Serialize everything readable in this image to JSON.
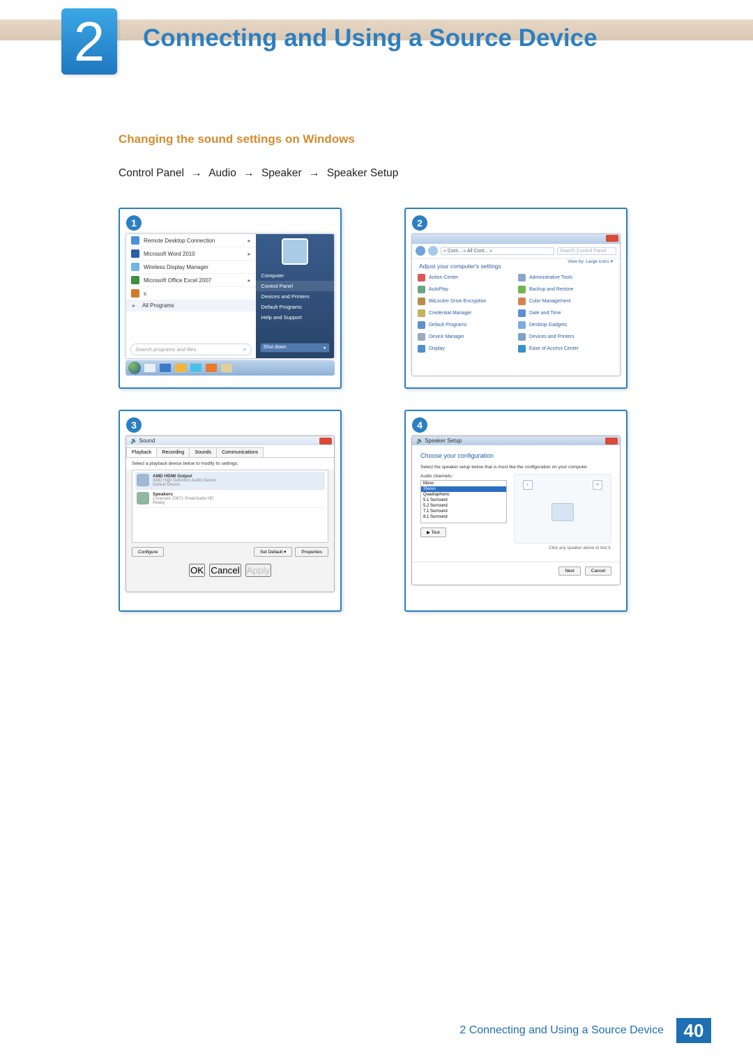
{
  "chapter": {
    "number": "2",
    "title": "Connecting and Using a Source Device"
  },
  "section_heading": "Changing the sound settings on Windows",
  "path": {
    "p1": "Control Panel",
    "p2": "Audio",
    "p3": "Speaker",
    "p4": "Speaker Setup",
    "arrow": "→"
  },
  "steps": {
    "n1": "1",
    "n2": "2",
    "n3": "3",
    "n4": "4"
  },
  "start_menu": {
    "items": [
      "Remote Desktop Connection",
      "Microsoft Word 2010",
      "Wireless Display Manager",
      "Microsoft Office Excel 2007",
      "s"
    ],
    "all_programs": "All Programs",
    "search_placeholder": "Search programs and files",
    "right": [
      "Computer",
      "Control Panel",
      "Devices and Printers",
      "Default Programs",
      "Help and Support"
    ],
    "shutdown": "Shut down"
  },
  "control_panel": {
    "breadcrumb": "« Cont... » All Cont... »",
    "search_placeholder": "Search Control Panel",
    "adjust": "Adjust your computer's settings",
    "view": "View by:  Large icons ▾",
    "items_left": [
      "Action Center",
      "AutoPlay",
      "BitLocker Drive Encryption",
      "Credential Manager",
      "Default Programs",
      "Device Manager",
      "Display"
    ],
    "items_right": [
      "Administrative Tools",
      "Backup and Restore",
      "Color Management",
      "Date and Time",
      "Desktop Gadgets",
      "Devices and Printers",
      "Ease of Access Center"
    ]
  },
  "sound_dialog": {
    "title": "Sound",
    "tabs": [
      "Playback",
      "Recording",
      "Sounds",
      "Communications"
    ],
    "instruction": "Select a playback device below to modify its settings:",
    "dev1": {
      "name": "AMD HDMI Output",
      "sub": "AMD High Definition Audio Device",
      "state": "Default Device"
    },
    "dev2": {
      "name": "Speakers",
      "sub": "Conexant 20671 SmartAudio HD",
      "state": "Ready"
    },
    "configure": "Configure",
    "set_default": "Set Default  ▾",
    "properties": "Properties",
    "ok": "OK",
    "cancel": "Cancel",
    "apply": "Apply"
  },
  "speaker_setup": {
    "title": "Speaker Setup",
    "heading": "Choose your configuration",
    "text": "Select the speaker setup below that is most like the configuration on your computer.",
    "label": "Audio channels:",
    "options": [
      "Mono",
      "Stereo",
      "Quadraphonic",
      "5.1 Surround",
      "5.2 Surround",
      "7.1 Surround",
      "8.1 Surround"
    ],
    "selected": "Stereo",
    "test": "▶ Test",
    "hint": "Click any speaker above to test it.",
    "next": "Next",
    "cancel": "Cancel",
    "spk_l": "L",
    "spk_r": "R"
  },
  "footer": {
    "text": "2 Connecting and Using a Source Device",
    "page": "40"
  }
}
